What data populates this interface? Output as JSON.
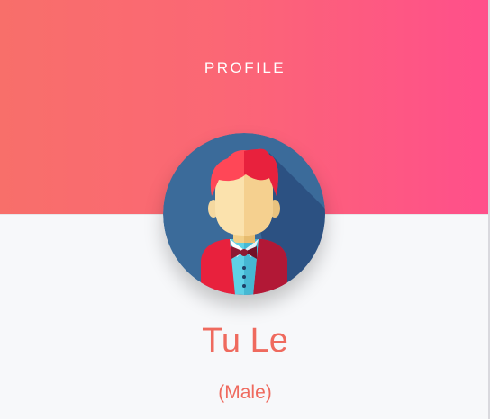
{
  "header": {
    "title": "PROFILE",
    "gradient_start": "#f86f6a",
    "gradient_end": "#ff4f8b"
  },
  "profile": {
    "avatar_icon": "male-waiter-avatar-icon",
    "name": "Tu Le",
    "gender": "(Male)",
    "text_color": "#ef6a5e"
  }
}
